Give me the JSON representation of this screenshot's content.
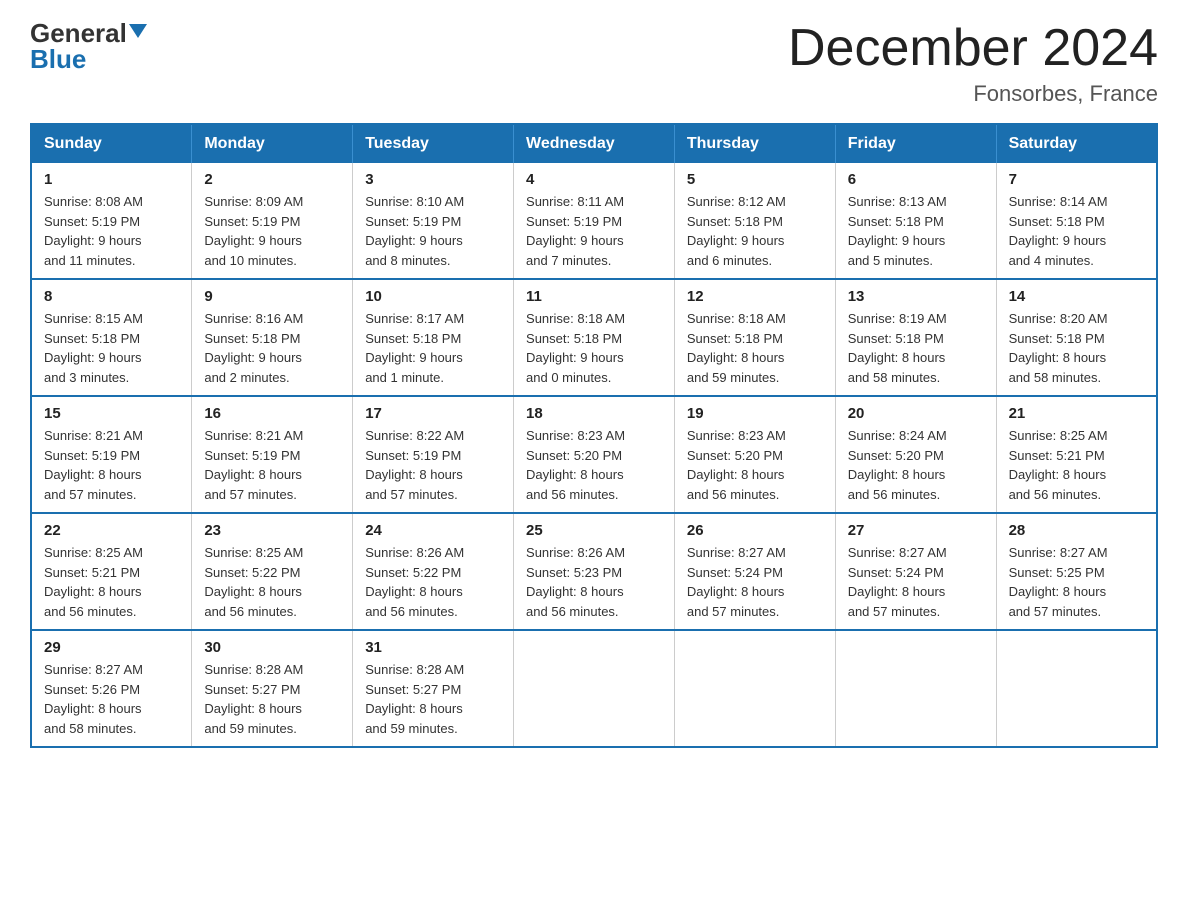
{
  "logo": {
    "general": "General",
    "blue": "Blue"
  },
  "title": "December 2024",
  "subtitle": "Fonsorbes, France",
  "days_header": [
    "Sunday",
    "Monday",
    "Tuesday",
    "Wednesday",
    "Thursday",
    "Friday",
    "Saturday"
  ],
  "weeks": [
    [
      {
        "day": "1",
        "sunrise": "8:08 AM",
        "sunset": "5:19 PM",
        "daylight": "9 hours and 11 minutes."
      },
      {
        "day": "2",
        "sunrise": "8:09 AM",
        "sunset": "5:19 PM",
        "daylight": "9 hours and 10 minutes."
      },
      {
        "day": "3",
        "sunrise": "8:10 AM",
        "sunset": "5:19 PM",
        "daylight": "9 hours and 8 minutes."
      },
      {
        "day": "4",
        "sunrise": "8:11 AM",
        "sunset": "5:19 PM",
        "daylight": "9 hours and 7 minutes."
      },
      {
        "day": "5",
        "sunrise": "8:12 AM",
        "sunset": "5:18 PM",
        "daylight": "9 hours and 6 minutes."
      },
      {
        "day": "6",
        "sunrise": "8:13 AM",
        "sunset": "5:18 PM",
        "daylight": "9 hours and 5 minutes."
      },
      {
        "day": "7",
        "sunrise": "8:14 AM",
        "sunset": "5:18 PM",
        "daylight": "9 hours and 4 minutes."
      }
    ],
    [
      {
        "day": "8",
        "sunrise": "8:15 AM",
        "sunset": "5:18 PM",
        "daylight": "9 hours and 3 minutes."
      },
      {
        "day": "9",
        "sunrise": "8:16 AM",
        "sunset": "5:18 PM",
        "daylight": "9 hours and 2 minutes."
      },
      {
        "day": "10",
        "sunrise": "8:17 AM",
        "sunset": "5:18 PM",
        "daylight": "9 hours and 1 minute."
      },
      {
        "day": "11",
        "sunrise": "8:18 AM",
        "sunset": "5:18 PM",
        "daylight": "9 hours and 0 minutes."
      },
      {
        "day": "12",
        "sunrise": "8:18 AM",
        "sunset": "5:18 PM",
        "daylight": "8 hours and 59 minutes."
      },
      {
        "day": "13",
        "sunrise": "8:19 AM",
        "sunset": "5:18 PM",
        "daylight": "8 hours and 58 minutes."
      },
      {
        "day": "14",
        "sunrise": "8:20 AM",
        "sunset": "5:18 PM",
        "daylight": "8 hours and 58 minutes."
      }
    ],
    [
      {
        "day": "15",
        "sunrise": "8:21 AM",
        "sunset": "5:19 PM",
        "daylight": "8 hours and 57 minutes."
      },
      {
        "day": "16",
        "sunrise": "8:21 AM",
        "sunset": "5:19 PM",
        "daylight": "8 hours and 57 minutes."
      },
      {
        "day": "17",
        "sunrise": "8:22 AM",
        "sunset": "5:19 PM",
        "daylight": "8 hours and 57 minutes."
      },
      {
        "day": "18",
        "sunrise": "8:23 AM",
        "sunset": "5:20 PM",
        "daylight": "8 hours and 56 minutes."
      },
      {
        "day": "19",
        "sunrise": "8:23 AM",
        "sunset": "5:20 PM",
        "daylight": "8 hours and 56 minutes."
      },
      {
        "day": "20",
        "sunrise": "8:24 AM",
        "sunset": "5:20 PM",
        "daylight": "8 hours and 56 minutes."
      },
      {
        "day": "21",
        "sunrise": "8:25 AM",
        "sunset": "5:21 PM",
        "daylight": "8 hours and 56 minutes."
      }
    ],
    [
      {
        "day": "22",
        "sunrise": "8:25 AM",
        "sunset": "5:21 PM",
        "daylight": "8 hours and 56 minutes."
      },
      {
        "day": "23",
        "sunrise": "8:25 AM",
        "sunset": "5:22 PM",
        "daylight": "8 hours and 56 minutes."
      },
      {
        "day": "24",
        "sunrise": "8:26 AM",
        "sunset": "5:22 PM",
        "daylight": "8 hours and 56 minutes."
      },
      {
        "day": "25",
        "sunrise": "8:26 AM",
        "sunset": "5:23 PM",
        "daylight": "8 hours and 56 minutes."
      },
      {
        "day": "26",
        "sunrise": "8:27 AM",
        "sunset": "5:24 PM",
        "daylight": "8 hours and 57 minutes."
      },
      {
        "day": "27",
        "sunrise": "8:27 AM",
        "sunset": "5:24 PM",
        "daylight": "8 hours and 57 minutes."
      },
      {
        "day": "28",
        "sunrise": "8:27 AM",
        "sunset": "5:25 PM",
        "daylight": "8 hours and 57 minutes."
      }
    ],
    [
      {
        "day": "29",
        "sunrise": "8:27 AM",
        "sunset": "5:26 PM",
        "daylight": "8 hours and 58 minutes."
      },
      {
        "day": "30",
        "sunrise": "8:28 AM",
        "sunset": "5:27 PM",
        "daylight": "8 hours and 59 minutes."
      },
      {
        "day": "31",
        "sunrise": "8:28 AM",
        "sunset": "5:27 PM",
        "daylight": "8 hours and 59 minutes."
      },
      null,
      null,
      null,
      null
    ]
  ],
  "labels": {
    "sunrise": "Sunrise:",
    "sunset": "Sunset:",
    "daylight": "Daylight:"
  }
}
